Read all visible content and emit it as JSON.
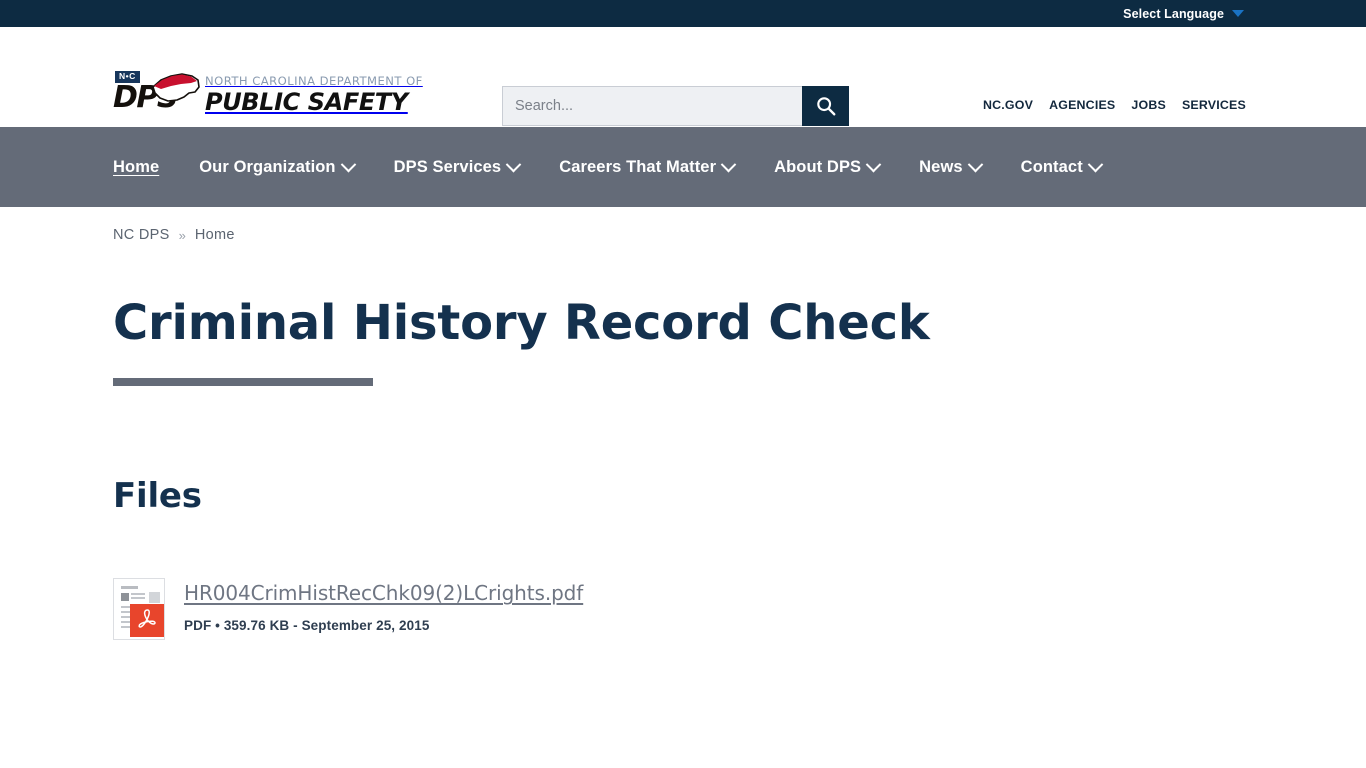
{
  "topbar": {
    "language_label": "Select Language",
    "caret_icon": "chevron-down-icon",
    "bg_color": "#0d2b42",
    "caret_color": "#1a73c4"
  },
  "header": {
    "logo": {
      "badge": "N•C",
      "acronym": "DPS",
      "line1": "NORTH CAROLINA DEPARTMENT OF",
      "line2": "PUBLIC SAFETY",
      "badge_color": "#17365c",
      "shape_color": "#c8102e"
    },
    "search": {
      "placeholder": "Search...",
      "value": "",
      "button_icon": "search-icon",
      "button_color": "#0d2b42"
    },
    "utility_links": [
      {
        "label": "NC.GOV"
      },
      {
        "label": "AGENCIES"
      },
      {
        "label": "JOBS"
      },
      {
        "label": "SERVICES"
      }
    ]
  },
  "nav": {
    "bg_color": "#646b78",
    "items": [
      {
        "label": "Home",
        "has_dropdown": false,
        "active": true
      },
      {
        "label": "Our Organization",
        "has_dropdown": true,
        "active": false
      },
      {
        "label": "DPS Services",
        "has_dropdown": true,
        "active": false
      },
      {
        "label": "Careers That Matter",
        "has_dropdown": true,
        "active": false
      },
      {
        "label": "About DPS",
        "has_dropdown": true,
        "active": false
      },
      {
        "label": "News",
        "has_dropdown": true,
        "active": false
      },
      {
        "label": "Contact",
        "has_dropdown": true,
        "active": false
      }
    ]
  },
  "breadcrumb": {
    "root": "NC DPS",
    "separator": "»",
    "current": "Home"
  },
  "main": {
    "page_title": "Criminal History Record Check",
    "rule_color": "#646b78",
    "files_heading": "Files",
    "files": [
      {
        "name": "HR004CrimHistRecChk09(2)LCrights.pdf",
        "type": "PDF",
        "size": "359.76 KB",
        "date": "September 25, 2015",
        "meta": "PDF • 359.76 KB - September 25, 2015",
        "icon": "pdf-file-icon"
      }
    ]
  }
}
